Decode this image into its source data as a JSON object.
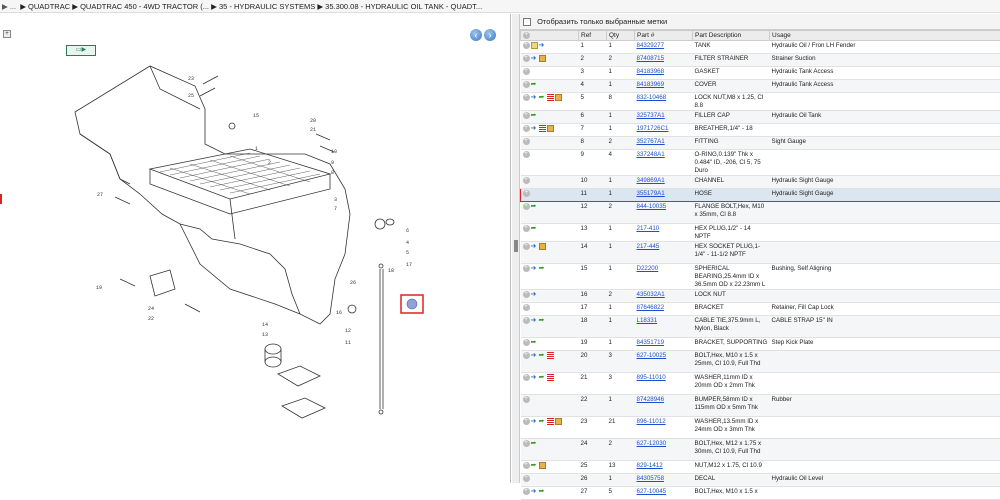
{
  "breadcrumb": {
    "home": "▶ ...",
    "items": [
      "▶ QUADTRAC",
      "▶ QUADTRAC 450 - 4WD TRACTOR (...",
      "▶ 35 - HYDRAULIC SYSTEMS",
      "▶ 35.300.08 - HYDRAULIC OIL TANK - QUADT..."
    ]
  },
  "nav": {
    "prev": "‹",
    "next": "›"
  },
  "filter": {
    "label": "Отобразить только выбранные метки"
  },
  "columns": {
    "ref": "Ref",
    "qty": "Qty",
    "part": "Part #",
    "desc": "Part Description",
    "usage": "Usage"
  },
  "callouts": [
    "23",
    "25",
    "1",
    "15",
    "20",
    "21",
    "2",
    "10",
    "9",
    "8",
    "3",
    "7",
    "27",
    "6",
    "4",
    "5",
    "17",
    "18",
    "12",
    "11",
    "16",
    "26",
    "14",
    "13",
    "19",
    "24",
    "22"
  ],
  "rows": [
    {
      "ref": "1",
      "qty": "1",
      "part": "84329277",
      "desc": "TANK",
      "usage": "Hydraulic Oil / Fron LH Fender",
      "icons": [
        "plus",
        "note",
        "info"
      ]
    },
    {
      "ref": "2",
      "qty": "2",
      "part": "87408715",
      "desc": "FILTER STRAINER",
      "usage": "Strainer Suction",
      "icons": [
        "plus",
        "info",
        "pack"
      ]
    },
    {
      "ref": "3",
      "qty": "1",
      "part": "84183968",
      "desc": "GASKET",
      "usage": "Hydraulic Tank Access",
      "icons": [
        "plus"
      ]
    },
    {
      "ref": "4",
      "qty": "1",
      "part": "84183969",
      "desc": "COVER",
      "usage": "Hydraulic Tank Access",
      "icons": [
        "plus",
        "go"
      ]
    },
    {
      "ref": "5",
      "qty": "8",
      "part": "832-10468",
      "desc": "LOCK NUT,M8 x 1.25, Cl 8.8",
      "usage": "",
      "icons": [
        "plus",
        "info",
        "go",
        "list",
        "pack"
      ]
    },
    {
      "ref": "6",
      "qty": "1",
      "part": "325737A1",
      "desc": "FILLER CAP",
      "usage": "Hydraulic Oil Tank",
      "icons": [
        "plus",
        "go"
      ]
    },
    {
      "ref": "7",
      "qty": "1",
      "part": "1971726C1",
      "desc": "BREATHER,1/4\" - 18",
      "usage": "",
      "icons": [
        "plus",
        "info",
        "list",
        "pack"
      ]
    },
    {
      "ref": "8",
      "qty": "2",
      "part": "352767A1",
      "desc": "FITTING",
      "usage": "Sight Gauge",
      "icons": [
        "plus"
      ]
    },
    {
      "ref": "9",
      "qty": "4",
      "part": "337248A1",
      "desc": "O-RING,0.139\" Thk x 0.484\" ID, -206, Cl 5, 75 Duro",
      "usage": "",
      "icons": [
        "plus"
      ]
    },
    {
      "ref": "10",
      "qty": "1",
      "part": "349869A1",
      "desc": "CHANNEL",
      "usage": "Hydraulic Sight Gauge",
      "icons": [
        "plus"
      ]
    },
    {
      "ref": "11",
      "qty": "1",
      "part": "355179A1",
      "desc": "HOSE",
      "usage": "Hydraulic Sight Gauge",
      "icons": [
        "plus"
      ]
    },
    {
      "ref": "12",
      "qty": "2",
      "part": "844-10035",
      "desc": "FLANGE BOLT,Hex, M10 x 35mm, Cl 8.8",
      "usage": "",
      "icons": [
        "plus",
        "go"
      ]
    },
    {
      "ref": "13",
      "qty": "1",
      "part": "217-410",
      "desc": "HEX PLUG,1/2\" - 14 NPTF",
      "usage": "",
      "icons": [
        "plus",
        "go"
      ]
    },
    {
      "ref": "14",
      "qty": "1",
      "part": "217-445",
      "desc": "HEX SOCKET PLUG,1-1/4\" - 11-1/2 NPTF",
      "usage": "",
      "icons": [
        "plus",
        "info",
        "pack"
      ]
    },
    {
      "ref": "15",
      "qty": "1",
      "part": "D22200",
      "desc": "SPHERICAL BEARING,25.4mm ID x 36.5mm OD x 22.23mm L",
      "usage": "Bushing, Self Aligning",
      "icons": [
        "plus",
        "info",
        "go"
      ]
    },
    {
      "ref": "16",
      "qty": "2",
      "part": "435032A1",
      "desc": "LOCK NUT",
      "usage": "",
      "icons": [
        "plus",
        "info"
      ]
    },
    {
      "ref": "17",
      "qty": "1",
      "part": "87646822",
      "desc": "BRACKET",
      "usage": "Retainer, Fill Cap Lock",
      "icons": [
        "plus"
      ]
    },
    {
      "ref": "18",
      "qty": "1",
      "part": "L18331",
      "desc": "CABLE TIE,375.9mm L, Nylon, Black",
      "usage": "CABLE STRAP 15\" IN",
      "icons": [
        "plus",
        "info",
        "go"
      ]
    },
    {
      "ref": "19",
      "qty": "1",
      "part": "84351719",
      "desc": "BRACKET, SUPPORTING",
      "usage": "Step Kick Plate",
      "icons": [
        "plus",
        "go"
      ]
    },
    {
      "ref": "20",
      "qty": "3",
      "part": "627-10025",
      "desc": "BOLT,Hex, M10 x 1.5 x 25mm, Cl 10.9, Full Thd",
      "usage": "",
      "icons": [
        "plus",
        "info",
        "go",
        "list"
      ]
    },
    {
      "ref": "21",
      "qty": "3",
      "part": "895-11010",
      "desc": "WASHER,11mm ID x 20mm OD x 2mm Thk",
      "usage": "",
      "icons": [
        "plus",
        "info",
        "go",
        "list"
      ]
    },
    {
      "ref": "22",
      "qty": "1",
      "part": "87428946",
      "desc": "BUMPER,58mm ID x 115mm OD x 5mm Thk",
      "usage": "Rubber",
      "icons": [
        "plus"
      ]
    },
    {
      "ref": "23",
      "qty": "21",
      "part": "896-11012",
      "desc": "WASHER,13.5mm ID x 24mm OD x 3mm Thk",
      "usage": "",
      "icons": [
        "plus",
        "info",
        "go",
        "list",
        "pack"
      ]
    },
    {
      "ref": "24",
      "qty": "2",
      "part": "627-12030",
      "desc": "BOLT,Hex, M12 x 1.75 x 30mm, Cl 10.9, Full Thd",
      "usage": "",
      "icons": [
        "plus",
        "go"
      ]
    },
    {
      "ref": "25",
      "qty": "13",
      "part": "829-1412",
      "desc": "NUT,M12 x 1.75, Cl 10.9",
      "usage": "",
      "icons": [
        "plus",
        "go",
        "pack"
      ]
    },
    {
      "ref": "26",
      "qty": "1",
      "part": "84305758",
      "desc": "DECAL",
      "usage": "Hydraulic Oil Level",
      "icons": [
        "plus"
      ]
    },
    {
      "ref": "27",
      "qty": "5",
      "part": "627-10045",
      "desc": "BOLT,Hex, M10 x 1.5 x",
      "usage": "",
      "icons": [
        "plus",
        "info",
        "go"
      ]
    }
  ],
  "selected_ref": "11"
}
